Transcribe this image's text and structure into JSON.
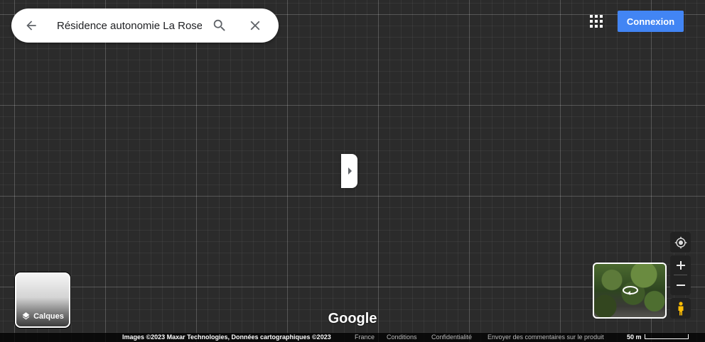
{
  "search": {
    "value": "Résidence autonomie La Roseraie",
    "back_icon": "arrow-left-icon",
    "search_icon": "search-icon",
    "close_icon": "close-icon"
  },
  "header": {
    "apps_icon": "apps-grid-icon",
    "login_label": "Connexion",
    "login_color": "#4285f4"
  },
  "side_panel_toggle_icon": "chevron-right-icon",
  "layers": {
    "label": "Calques",
    "icon": "layers-icon"
  },
  "logo": "Google",
  "controls": {
    "location_icon": "my-location-icon",
    "zoom_in_label": "+",
    "zoom_out_label": "−",
    "pegman_icon": "pegman-icon",
    "streetview_icon": "rotate-360-icon"
  },
  "footer": {
    "attribution": "Images ©2023 Maxar Technologies, Données cartographiques ©2023",
    "country": "France",
    "conditions": "Conditions",
    "privacy": "Confidentialité",
    "feedback": "Envoyer des commentaires sur le produit",
    "scale": "50 m"
  }
}
